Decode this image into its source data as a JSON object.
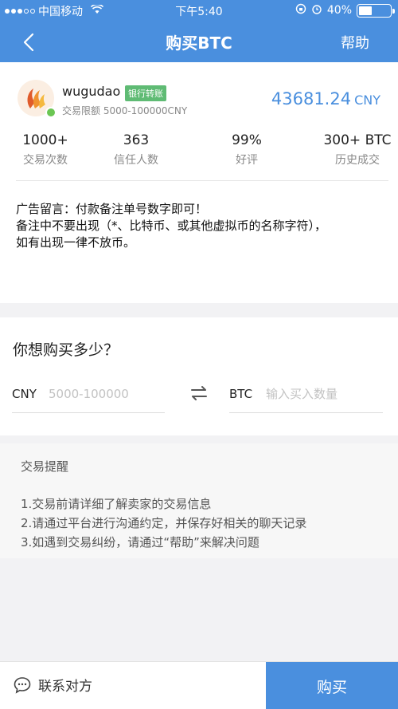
{
  "status_bar": {
    "carrier": "中国移动",
    "time": "下午5:40",
    "battery": "40%",
    "battery_level": 0.4
  },
  "nav": {
    "title": "购买BTC",
    "help": "帮助"
  },
  "seller": {
    "name": "wugudao",
    "badge": "银行转账",
    "limit": "交易限额 5000-100000CNY",
    "price": "43681.24",
    "price_currency": "CNY",
    "online_color": "#6bc653"
  },
  "stats": [
    {
      "value": "1000+",
      "label": "交易次数"
    },
    {
      "value": "363",
      "label": "信任人数"
    },
    {
      "value": "99%",
      "label": "好评"
    },
    {
      "value": "300+ BTC",
      "label": "历史成交"
    }
  ],
  "notes": {
    "line1": "广告留言：付款备注单号数字即可！",
    "line2": "备注中不要出现（*、比特币、或其他虚拟币的名称字符），",
    "line3": "如有出现一律不放币。"
  },
  "buy": {
    "question": "你想购买多少？",
    "cny_code": "CNY",
    "cny_placeholder": "5000-100000",
    "btc_code": "BTC",
    "btc_placeholder": "输入买入数量"
  },
  "reminder": {
    "title": "交易提醒",
    "items": [
      "1.交易前请详细了解卖家的交易信息",
      "2.请通过平台进行沟通约定，并保存好相关的聊天记录",
      "3.如遇到交易纠纷，请通过“帮助”来解决问题"
    ]
  },
  "bottom": {
    "contact": "联系对方",
    "buy_button": "购买"
  },
  "colors": {
    "primary": "#4a8fde",
    "badge": "#5fbb74"
  },
  "icons": [
    "back-chevron-icon",
    "wifi-icon",
    "alarm-icon",
    "lock-rotation-icon",
    "battery-icon",
    "swap-arrows-icon",
    "chat-bubble-icon"
  ]
}
